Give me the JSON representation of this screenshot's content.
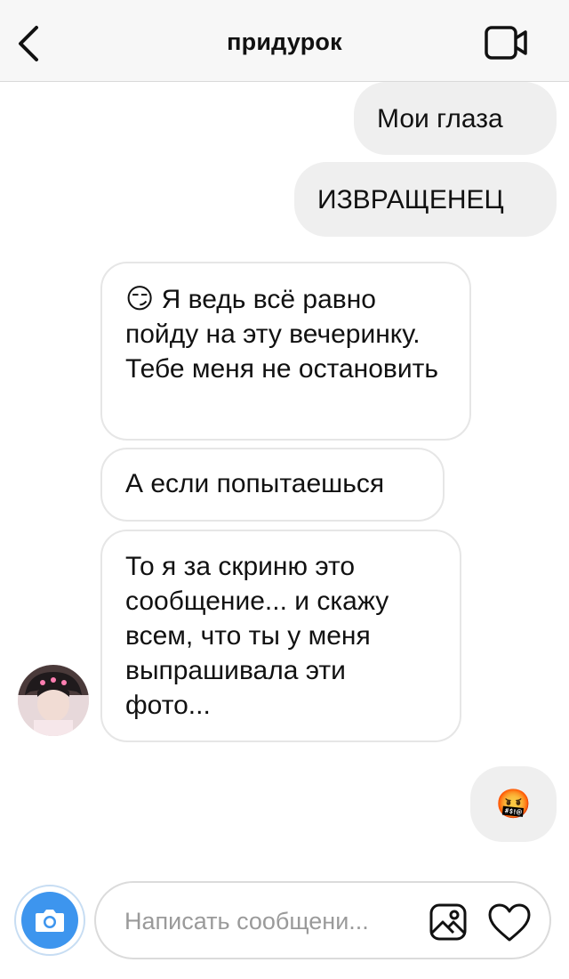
{
  "header": {
    "title": "придурок",
    "back_icon": "chevron-left-icon",
    "video_icon": "video-camera-icon"
  },
  "messages": [
    {
      "side": "sent",
      "text": "Мои глаза"
    },
    {
      "side": "sent",
      "text": "ИЗВРАЩЕНЕЦ"
    },
    {
      "side": "received",
      "emoji": "😏",
      "text": "Я ведь всё равно пойду на эту вечеринку. Тебе меня не остановить"
    },
    {
      "side": "received",
      "text": "А если попытаешься"
    },
    {
      "side": "received",
      "text": "То я за скриню это сообщение... и скажу всем, что ты у меня выпрашивала эти фото..."
    },
    {
      "side": "sent",
      "emoji": "🤬"
    }
  ],
  "composer": {
    "placeholder": "Написать сообщени...",
    "camera_icon": "camera-icon",
    "gallery_icon": "gallery-icon",
    "heart_icon": "heart-icon"
  },
  "colors": {
    "camera_button": "#3d95ee",
    "sent_bubble": "#efefef",
    "received_border": "#e6e6e6"
  }
}
